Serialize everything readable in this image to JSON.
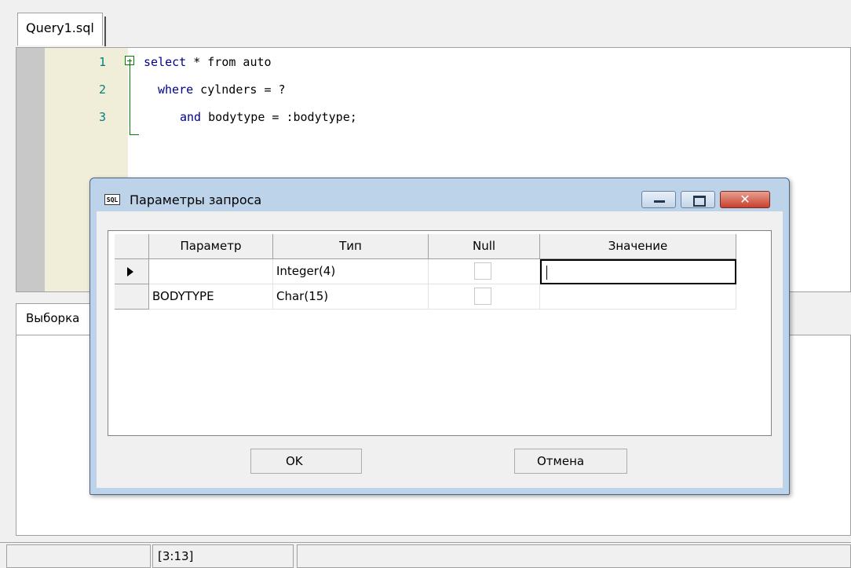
{
  "editor": {
    "tab_label": "Query1.sql",
    "lines": [
      {
        "num": "1",
        "kw": "select",
        "rest": " * from auto"
      },
      {
        "num": "2",
        "kw": "where",
        "rest": " cylnders = ?"
      },
      {
        "num": "3",
        "kw": "and",
        "rest": " bodytype = :bodytype;"
      }
    ]
  },
  "lower_panel": {
    "tab_label": "Выборка"
  },
  "statusbar": {
    "position": "[3:13]"
  },
  "dialog": {
    "title": "Параметры запроса",
    "icon_label": "SQL",
    "columns": [
      "Параметр",
      "Тип",
      "Null",
      "Значение"
    ],
    "rows": [
      {
        "param": "",
        "type": "Integer(4)",
        "null_checked": false,
        "value": ""
      },
      {
        "param": "BODYTYPE",
        "type": "Char(15)",
        "null_checked": false,
        "value": ""
      }
    ],
    "ok_label": "OK",
    "cancel_label": "Отмена"
  }
}
